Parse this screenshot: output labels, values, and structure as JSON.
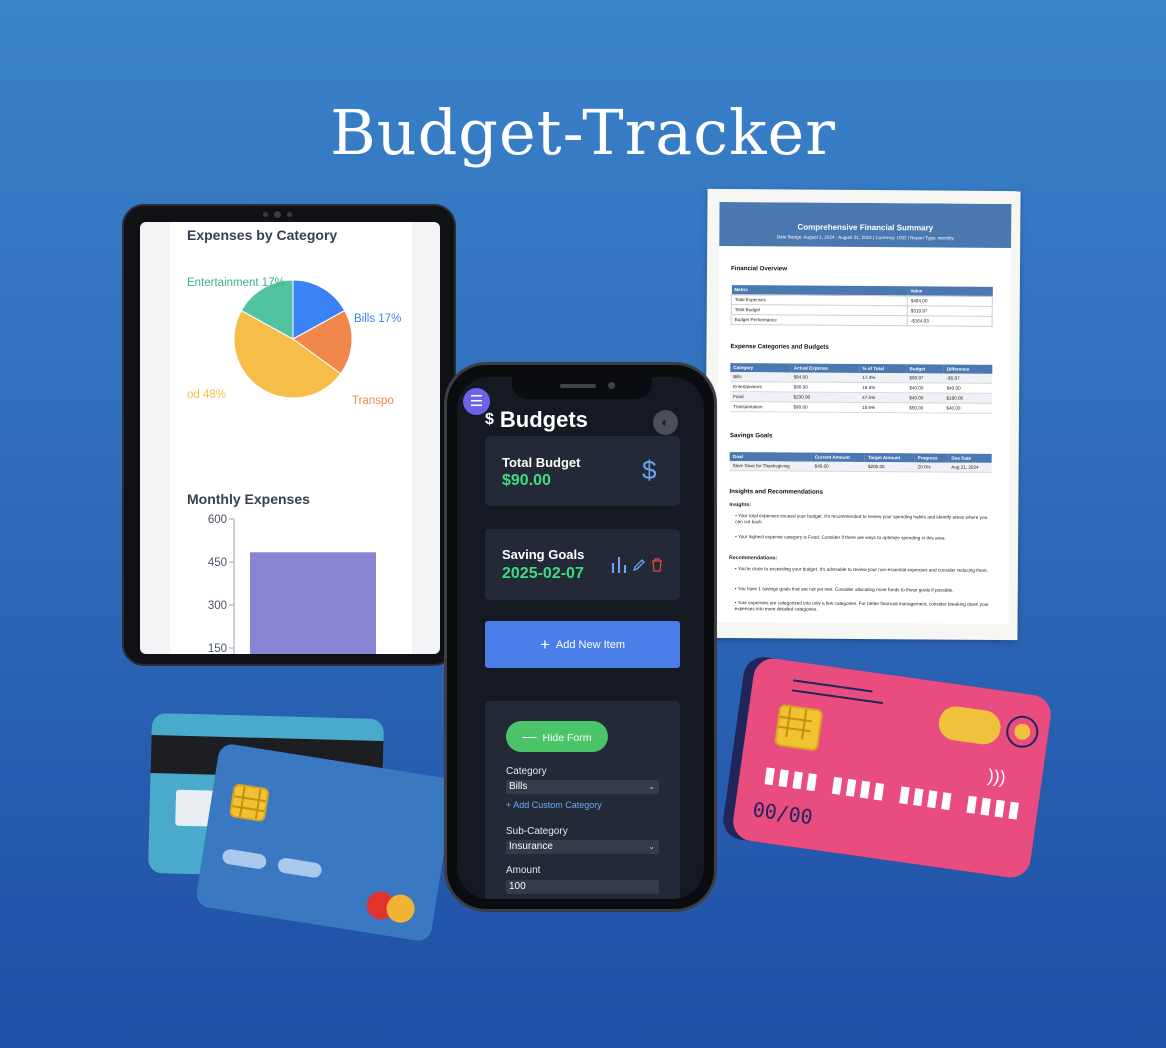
{
  "title": "Budget-Tracker",
  "tablet": {
    "pie": {
      "heading": "Expenses by Category",
      "slices": [
        {
          "name": "Bills",
          "percent": 17,
          "color": "#3b82f6",
          "label": "Bills 17%"
        },
        {
          "name": "Transportation",
          "percent": 18,
          "color": "#f0884c",
          "label": "Transpo"
        },
        {
          "name": "Food",
          "percent": 48,
          "color": "#f6bd49",
          "label": "od 48%"
        },
        {
          "name": "Entertainment",
          "percent": 17,
          "color": "#52c3a0",
          "label": "Entertainment 17%"
        }
      ]
    },
    "bar": {
      "heading": "Monthly Expenses",
      "ticks": [
        "600",
        "450",
        "300",
        "150"
      ],
      "bar_value": 484,
      "bar_color": "#8a85d3"
    }
  },
  "chart_data": [
    {
      "type": "pie",
      "title": "Expenses by Category",
      "categories": [
        "Bills",
        "Transportation",
        "Food",
        "Entertainment"
      ],
      "values": [
        17,
        18,
        48,
        17
      ]
    },
    {
      "type": "bar",
      "title": "Monthly Expenses",
      "values": [
        484
      ],
      "ylim": [
        0,
        600
      ],
      "yticks": [
        150,
        300,
        450,
        600
      ]
    }
  ],
  "phone": {
    "title": "Budgets",
    "title_icon": "$",
    "menu_icon": "☰",
    "theme_icon": "◐",
    "total_budget": {
      "label": "Total Budget",
      "value": "$90.00",
      "icon": "$"
    },
    "saving_goals": {
      "label": "Saving Goals",
      "value": "2025-02-07"
    },
    "add_button": "Add New Item",
    "hide_form_button": "Hide Form",
    "form": {
      "category_label": "Category",
      "category_value": "Bills",
      "add_custom": "+ Add Custom Category",
      "subcategory_label": "Sub-Category",
      "subcategory_value": "Insurance",
      "amount_label": "Amount",
      "amount_value": "100"
    }
  },
  "doc": {
    "title": "Comprehensive Financial Summary",
    "subtitle": "Date Range: August 1, 2024 - August 21, 2024 | Currency: USD | Report Type: monthly",
    "overview": {
      "heading": "Financial Overview",
      "headers": [
        "Metric",
        "Value"
      ],
      "rows": [
        [
          "Total Expenses",
          "$484.00"
        ],
        [
          "Total Budget",
          "$319.97"
        ],
        [
          "Budget Performance",
          "-$164.03"
        ]
      ]
    },
    "categories": {
      "heading": "Expense Categories and Budgets",
      "headers": [
        "Category",
        "Actual Expense",
        "% of Total",
        "Budget",
        "Difference"
      ],
      "rows": [
        [
          "Bills",
          "$84.00",
          "17.4%",
          "$89.97",
          "-$5.97"
        ],
        [
          "Entertainment",
          "$80.00",
          "16.5%",
          "$40.00",
          "$40.00"
        ],
        [
          "Food",
          "$230.00",
          "47.5%",
          "$40.00",
          "$190.00"
        ],
        [
          "Transportation",
          "$90.00",
          "18.6%",
          "$50.00",
          "$40.00"
        ]
      ]
    },
    "savings": {
      "heading": "Savings Goals",
      "headers": [
        "Goal",
        "Current Amount",
        "Target Amount",
        "Progress",
        "Due Date"
      ],
      "rows": [
        [
          "Save Save for Thanksgiving",
          "$40.00",
          "$200.00",
          "20.0%",
          "Aug 21, 2024"
        ]
      ]
    },
    "insights": {
      "heading": "Insights and Recommendations",
      "insights_label": "Insights:",
      "insight1": "• Your total expenses exceed your budget. It's recommended to review your spending habits and identify areas where you can cut back.",
      "insight2": "• Your highest expense category is Food. Consider if there are ways to optimize spending in this area.",
      "rec_label": "Recommendations:",
      "rec1": "• You're close to exceeding your budget. It's advisable to review your non-essential expenses and consider reducing them.",
      "rec2": "• You have 1 savings goals that are not yet met. Consider allocating more funds to these goals if possible.",
      "rec3": "• Your expenses are categorized into only a few categories. For better financial management, consider breaking down your expenses into more detailed categories."
    }
  },
  "card_pink": {
    "number_groups": [
      "▮▮▮▮",
      "▮▮▮▮",
      "▮▮▮▮",
      "▮▮▮▮"
    ],
    "expiry": "00/00",
    "contactless": ")))"
  }
}
